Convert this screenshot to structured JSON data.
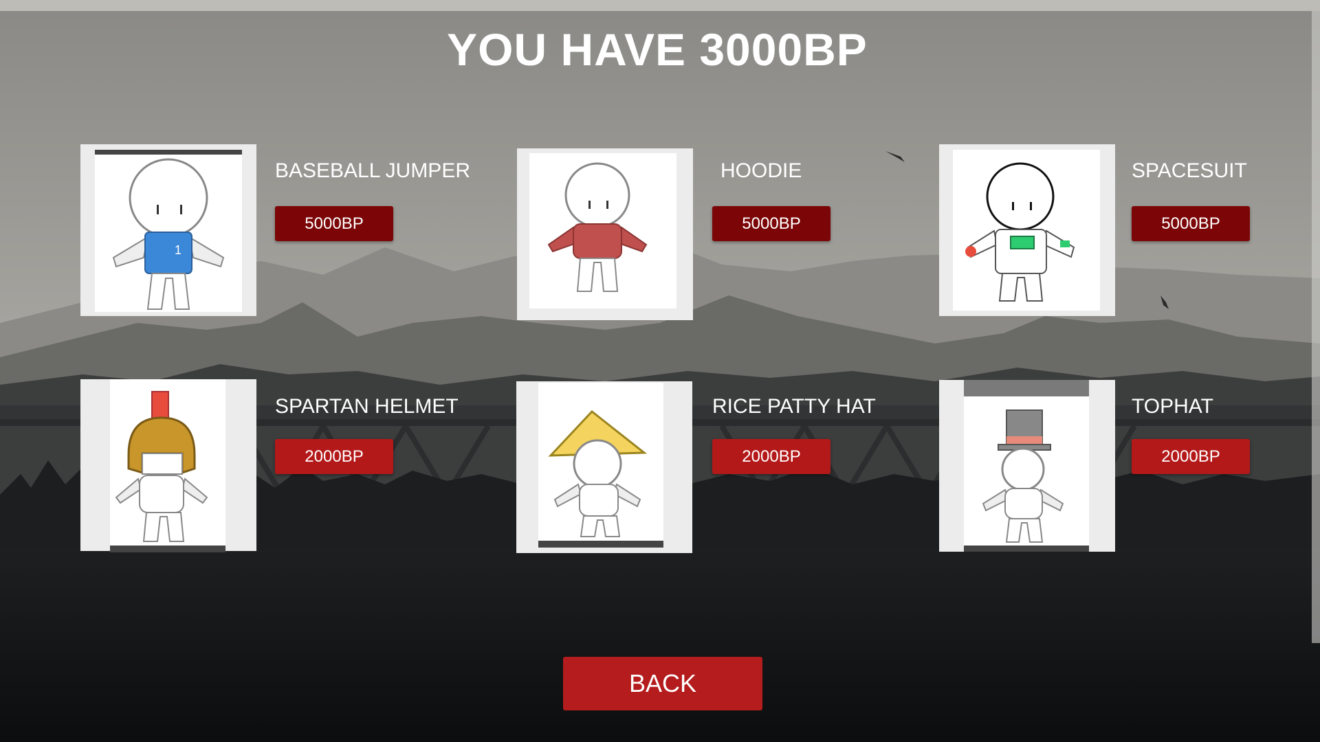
{
  "header": {
    "title": "YOU HAVE 3000BP"
  },
  "shop": {
    "items": [
      {
        "name": "BASEBALL JUMPER",
        "price": "5000BP",
        "icon": "baseball-jumper-icon"
      },
      {
        "name": "HOODIE",
        "price": "5000BP",
        "icon": "hoodie-icon"
      },
      {
        "name": "SPACESUIT",
        "price": "5000BP",
        "icon": "spacesuit-icon"
      },
      {
        "name": "SPARTAN HELMET",
        "price": "2000BP",
        "icon": "spartan-helmet-icon"
      },
      {
        "name": "RICE PATTY HAT",
        "price": "2000BP",
        "icon": "rice-patty-hat-icon"
      },
      {
        "name": "TOPHAT",
        "price": "2000BP",
        "icon": "tophat-icon"
      }
    ]
  },
  "footer": {
    "back_label": "BACK"
  },
  "colors": {
    "price_unaffordable": "#7c0607",
    "price_affordable": "#b4191a",
    "back_button": "#b41c1d",
    "text": "#ffffff"
  }
}
